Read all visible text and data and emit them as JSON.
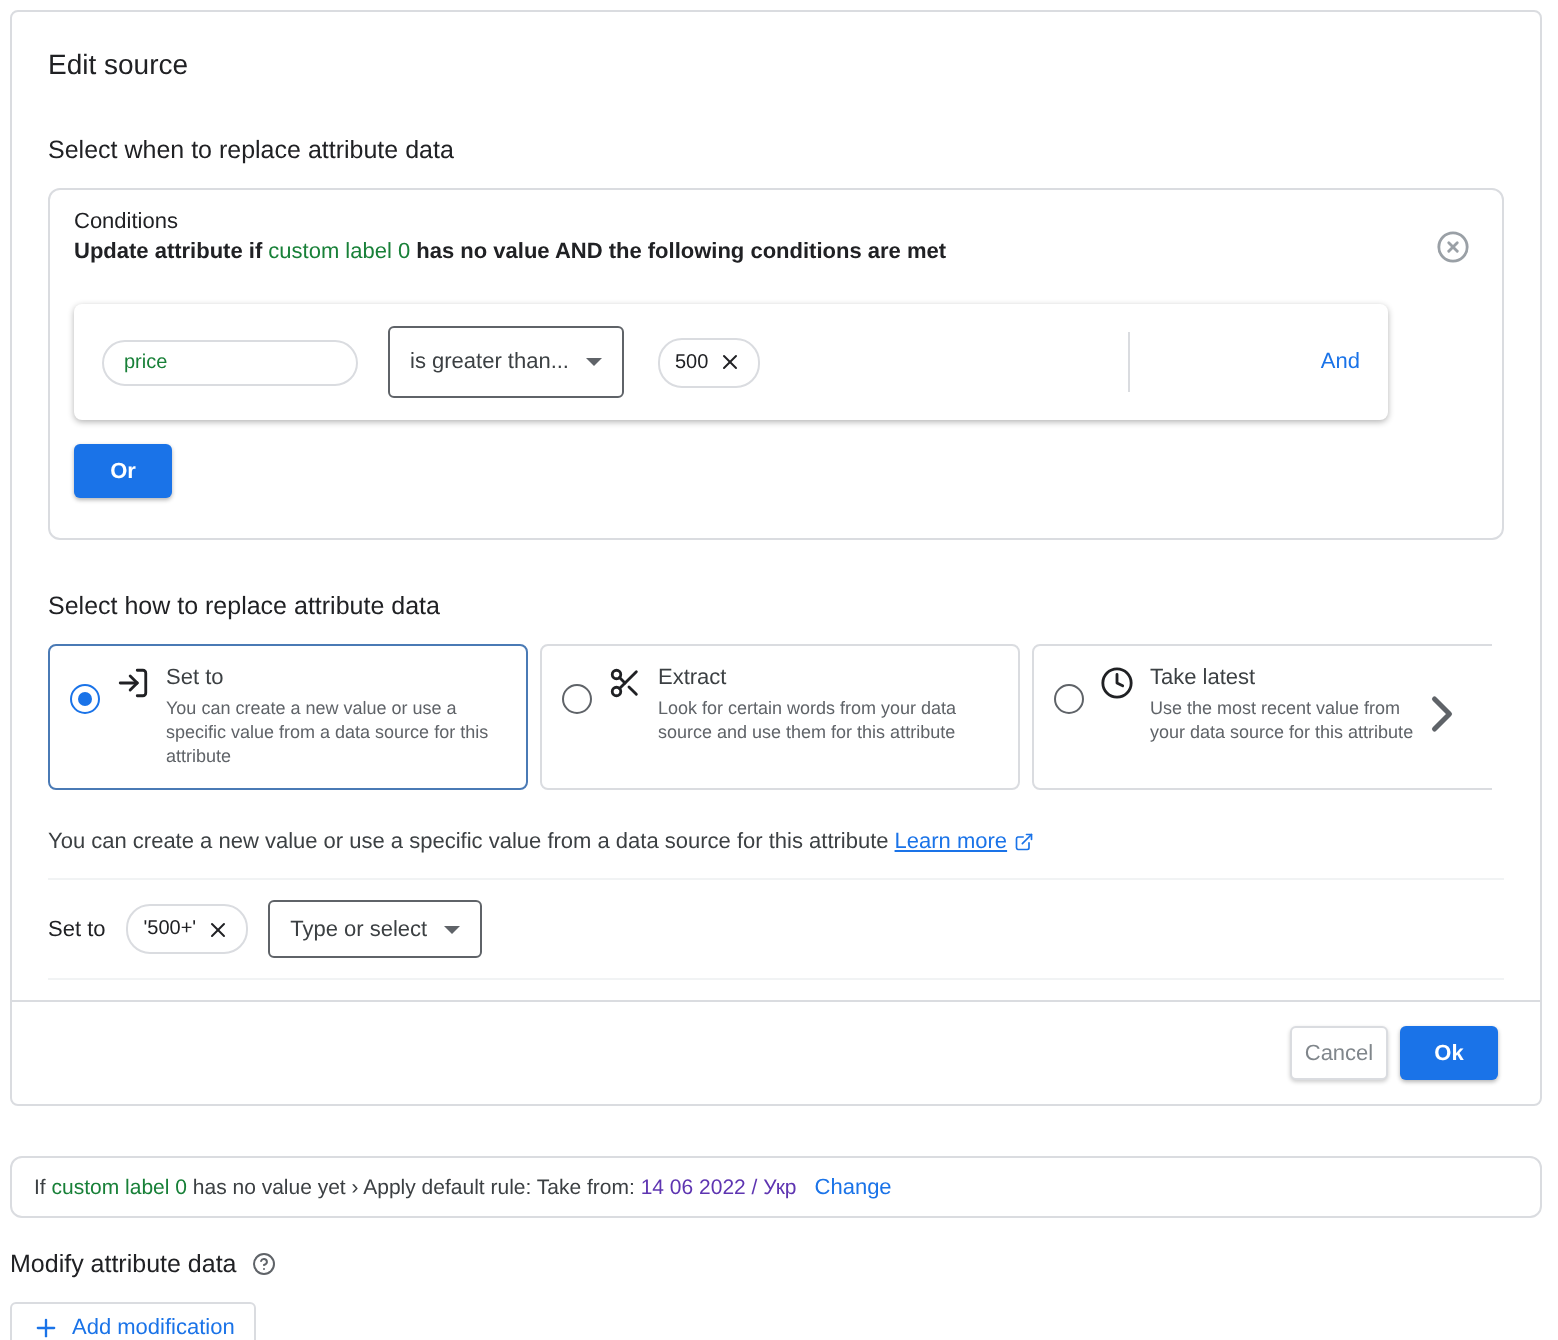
{
  "dialog": {
    "title": "Edit source",
    "when_heading": "Select when to replace attribute data",
    "conditions": {
      "label": "Conditions",
      "sentence": [
        {
          "kind": "plain",
          "text": "Update attribute if "
        },
        {
          "kind": "attribute",
          "text": "custom label 0"
        },
        {
          "kind": "plain",
          "text": " has no value AND the following conditions are met"
        }
      ],
      "rule": {
        "attribute": "price",
        "operator": "is greater than...",
        "values": [
          "500"
        ],
        "and_link": "And"
      },
      "or_button": "Or"
    },
    "how_heading": "Select how to replace attribute data",
    "methods": [
      {
        "kind": "set",
        "title": "Set to",
        "description": "You can create a new value or use a specific value from a data source for this attribute",
        "selected": true
      },
      {
        "kind": "extract",
        "title": "Extract",
        "description": "Look for certain words from your data source and use them for this attribute",
        "selected": false
      },
      {
        "kind": "latest",
        "title": "Take latest",
        "description": "Use the most recent value from your data source for this attribute",
        "selected": false
      }
    ],
    "method_hint": "You can create a new value or use a specific value from a data source for this attribute",
    "learn_more": "Learn more",
    "set_to": {
      "label": "Set to",
      "values": [
        "'500+'"
      ],
      "select_placeholder": "Type or select"
    },
    "buttons": [
      {
        "kind": "secondary",
        "label": "Cancel"
      },
      {
        "kind": "primary",
        "label": "Ok"
      }
    ]
  },
  "default_rule": {
    "parts": [
      {
        "kind": "plain",
        "text": "If "
      },
      {
        "kind": "attribute",
        "text": "custom label 0"
      },
      {
        "kind": "plain",
        "text": " has no value yet › Apply default rule: Take from: "
      },
      {
        "kind": "source",
        "text": "14 06 2022 / Укр"
      }
    ],
    "change_link": "Change"
  },
  "modify": {
    "heading": "Modify attribute data",
    "add_button": "Add modification"
  }
}
